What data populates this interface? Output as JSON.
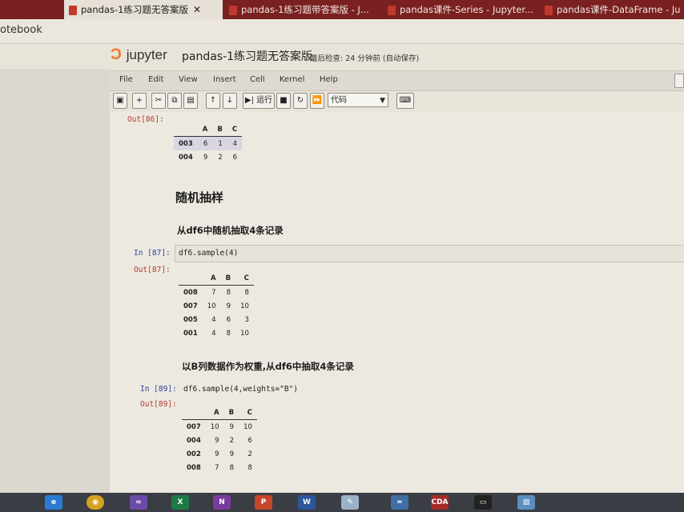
{
  "tabs": [
    {
      "title": "pandas-1练习题无答案版",
      "close": "✕",
      "active": true
    },
    {
      "title": "pandas-1练习题带答案版 - J..."
    },
    {
      "title": "pandas课件-Series - Jupyter..."
    },
    {
      "title": "pandas课件-DataFrame - Ju"
    }
  ],
  "address": {
    "text": "otebook"
  },
  "header": {
    "logo_text": "jupyter",
    "notebook_title": "pandas-1练习题无答案版",
    "checkpoint": "最后检查: 24 分钟前 (自动保存)"
  },
  "menu": [
    "File",
    "Edit",
    "View",
    "Insert",
    "Cell",
    "Kernel",
    "Help"
  ],
  "toolbar": {
    "run_label": "运行",
    "cell_type": "代码",
    "icons": [
      "save-icon",
      "plus-icon",
      "scissors-icon",
      "copy-icon",
      "paste-icon",
      "arrow-up-icon",
      "arrow-down-icon",
      "run-icon",
      "stop-icon",
      "restart-icon",
      "fast-forward-icon",
      "keyboard-icon"
    ]
  },
  "cells": {
    "out86": {
      "prompt": "Out[86]:",
      "columns": [
        "A",
        "B",
        "C"
      ],
      "rows": [
        {
          "index": "003",
          "values": [
            "6",
            "1",
            "4"
          ]
        },
        {
          "index": "004",
          "values": [
            "9",
            "2",
            "6"
          ]
        }
      ]
    },
    "heading_sampling": "随机抽样",
    "sub_heading_1": "从df6中随机抽取4条记录",
    "in87": {
      "prompt": "In [87]:",
      "code": "df6.sample(4)"
    },
    "out87": {
      "prompt": "Out[87]:",
      "columns": [
        "A",
        "B",
        "C"
      ],
      "rows": [
        {
          "index": "008",
          "values": [
            "7",
            "8",
            "8"
          ]
        },
        {
          "index": "007",
          "values": [
            "10",
            "9",
            "10"
          ]
        },
        {
          "index": "005",
          "values": [
            "4",
            "6",
            "3"
          ]
        },
        {
          "index": "001",
          "values": [
            "4",
            "8",
            "10"
          ]
        }
      ]
    },
    "sub_heading_2": "以B列数据作为权重,从df6中抽取4条记录",
    "in89": {
      "prompt": "In [89]:",
      "code": "df6.sample(4,weights=\"B\")"
    },
    "out89": {
      "prompt": "Out[89]:",
      "columns": [
        "A",
        "B",
        "C"
      ],
      "rows": [
        {
          "index": "007",
          "values": [
            "10",
            "9",
            "10"
          ]
        },
        {
          "index": "004",
          "values": [
            "9",
            "2",
            "6"
          ]
        },
        {
          "index": "002",
          "values": [
            "9",
            "9",
            "2"
          ]
        },
        {
          "index": "008",
          "values": [
            "7",
            "8",
            "8"
          ]
        }
      ]
    }
  },
  "taskbar": {
    "icons": [
      "ie-icon",
      "chrome-icon",
      "vs-icon",
      "excel-icon",
      "onenote-icon",
      "powerpoint-icon",
      "word-icon",
      "paint-icon",
      "network-icon",
      "cda-icon",
      "terminal-icon",
      "photo-icon"
    ],
    "cda_label": "CDA"
  },
  "colors": {
    "tabbar": "#7a2020",
    "out_prompt": "#b33a2a",
    "in_prompt": "#303f9f",
    "jupyter_orange": "#f37626"
  }
}
